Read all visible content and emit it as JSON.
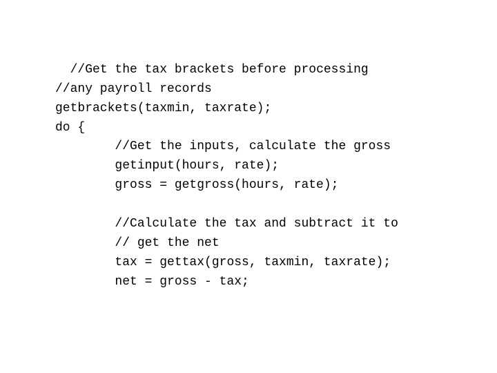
{
  "code": {
    "lines": [
      "//Get the tax brackets before processing",
      "//any payroll records",
      "getbrackets(taxmin, taxrate);",
      "do {",
      "        //Get the inputs, calculate the gross",
      "        getinput(hours, rate);",
      "        gross = getgross(hours, rate);",
      "",
      "        //Calculate the tax and subtract it to",
      "        // get the net",
      "        tax = gettax(gross, taxmin, taxrate);",
      "        net = gross - tax;"
    ]
  }
}
